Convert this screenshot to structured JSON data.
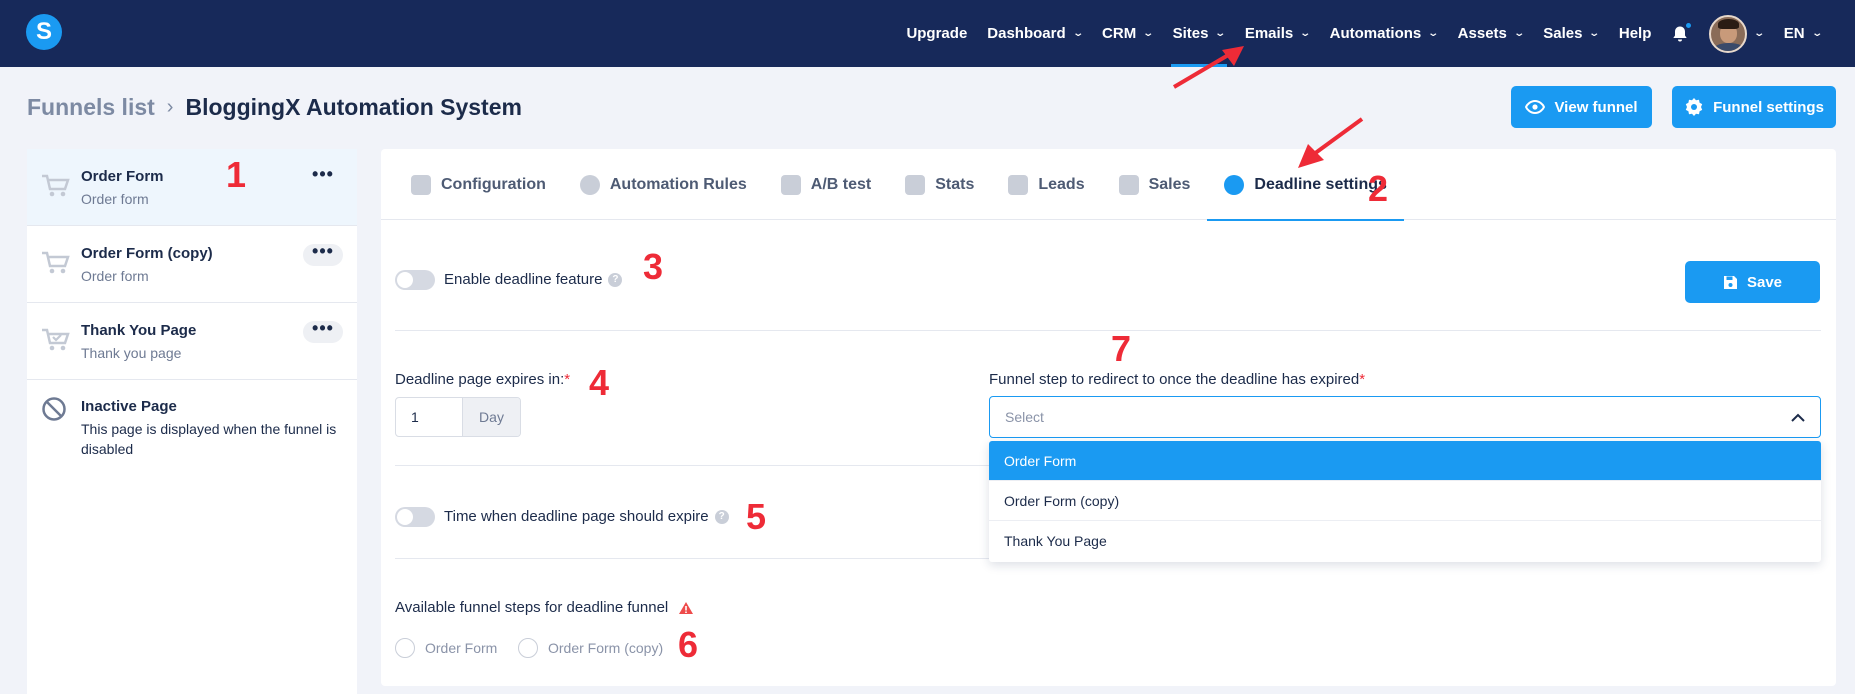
{
  "nav": {
    "logo": "S",
    "items": [
      {
        "label": "Upgrade",
        "chevron": false
      },
      {
        "label": "Dashboard",
        "chevron": true
      },
      {
        "label": "CRM",
        "chevron": true
      },
      {
        "label": "Sites",
        "chevron": true,
        "active": true
      },
      {
        "label": "Emails",
        "chevron": true
      },
      {
        "label": "Automations",
        "chevron": true
      },
      {
        "label": "Assets",
        "chevron": true
      },
      {
        "label": "Sales",
        "chevron": true
      },
      {
        "label": "Help",
        "chevron": false
      }
    ],
    "language": "EN"
  },
  "header": {
    "crumb_parent": "Funnels list",
    "crumb_current": "BloggingX Automation System",
    "view_funnel": "View funnel",
    "funnel_settings": "Funnel settings"
  },
  "sidebar": {
    "items": [
      {
        "title": "Order Form",
        "sub": "Order form"
      },
      {
        "title": "Order Form (copy)",
        "sub": "Order form"
      },
      {
        "title": "Thank You Page",
        "sub": "Thank you page"
      },
      {
        "title": "Inactive Page",
        "sub": "This page is displayed when the funnel is disabled"
      }
    ],
    "more": "•••"
  },
  "tabs": [
    {
      "label": "Configuration"
    },
    {
      "label": "Automation Rules"
    },
    {
      "label": "A/B test"
    },
    {
      "label": "Stats"
    },
    {
      "label": "Leads"
    },
    {
      "label": "Sales"
    },
    {
      "label": "Deadline settings",
      "active": true
    }
  ],
  "form": {
    "enable_label": "Enable deadline feature",
    "save": "Save",
    "expires_label": "Deadline page expires in:",
    "required": "*",
    "expires_value": "1",
    "expires_unit": "Day",
    "redirect_label": "Funnel step to redirect to once the deadline has expired",
    "select_placeholder": "Select",
    "options": [
      "Order Form",
      "Order Form (copy)",
      "Thank You Page"
    ],
    "time_label": "Time when deadline page should expire",
    "available_label": "Available funnel steps for deadline funnel",
    "radio_options": [
      "Order Form",
      "Order Form (copy)"
    ]
  },
  "annotations": [
    "1",
    "2",
    "3",
    "4",
    "5",
    "6",
    "7"
  ],
  "colors": {
    "nav_bg": "#17295a",
    "accent": "#1a9af2",
    "annotation": "#ee2b37"
  }
}
